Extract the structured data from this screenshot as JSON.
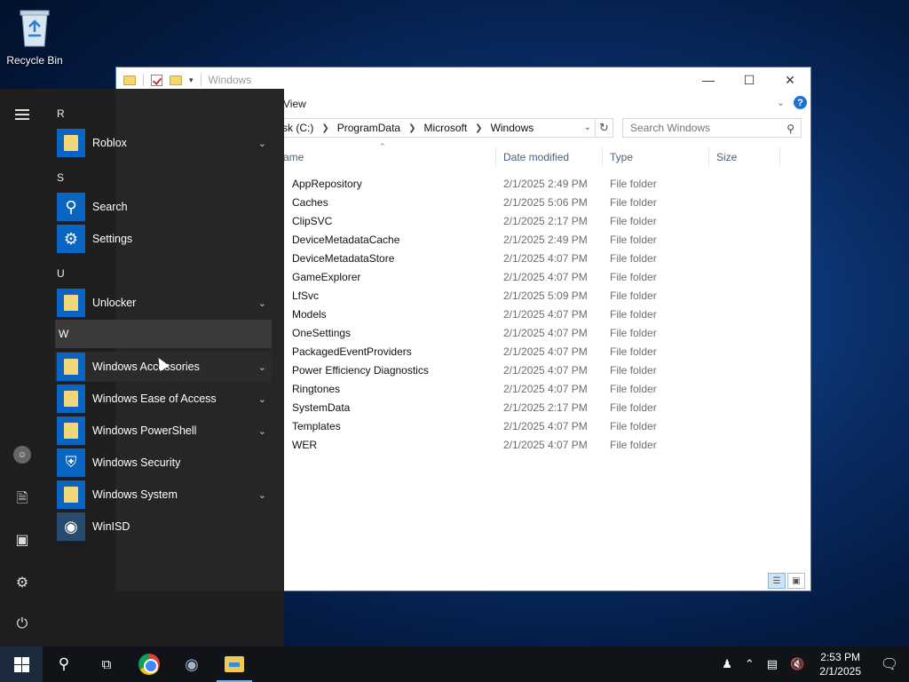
{
  "desktop": {
    "recycle_bin_label": "Recycle Bin"
  },
  "explorer": {
    "title": "Windows",
    "ribbon_view_tab": "View",
    "path": [
      "sk (C:)",
      "ProgramData",
      "Microsoft",
      "Windows"
    ],
    "search_placeholder": "Search Windows",
    "columns": {
      "name": "ame",
      "date": "Date modified",
      "type": "Type",
      "size": "Size"
    },
    "rows": [
      {
        "name": "AppRepository",
        "date": "2/1/2025 2:49 PM",
        "type": "File folder"
      },
      {
        "name": "Caches",
        "date": "2/1/2025 5:06 PM",
        "type": "File folder"
      },
      {
        "name": "ClipSVC",
        "date": "2/1/2025 2:17 PM",
        "type": "File folder"
      },
      {
        "name": "DeviceMetadataCache",
        "date": "2/1/2025 2:49 PM",
        "type": "File folder"
      },
      {
        "name": "DeviceMetadataStore",
        "date": "2/1/2025 4:07 PM",
        "type": "File folder"
      },
      {
        "name": "GameExplorer",
        "date": "2/1/2025 4:07 PM",
        "type": "File folder"
      },
      {
        "name": "LfSvc",
        "date": "2/1/2025 5:09 PM",
        "type": "File folder"
      },
      {
        "name": "Models",
        "date": "2/1/2025 4:07 PM",
        "type": "File folder"
      },
      {
        "name": "OneSettings",
        "date": "2/1/2025 4:07 PM",
        "type": "File folder"
      },
      {
        "name": "PackagedEventProviders",
        "date": "2/1/2025 4:07 PM",
        "type": "File folder"
      },
      {
        "name": "Power Efficiency Diagnostics",
        "date": "2/1/2025 4:07 PM",
        "type": "File folder"
      },
      {
        "name": "Ringtones",
        "date": "2/1/2025 4:07 PM",
        "type": "File folder"
      },
      {
        "name": "SystemData",
        "date": "2/1/2025 2:17 PM",
        "type": "File folder"
      },
      {
        "name": "Templates",
        "date": "2/1/2025 4:07 PM",
        "type": "File folder"
      },
      {
        "name": "WER",
        "date": "2/1/2025 4:07 PM",
        "type": "File folder"
      }
    ]
  },
  "start_menu": {
    "letters": {
      "r": "R",
      "s": "S",
      "u": "U",
      "w": "W"
    },
    "apps": {
      "roblox": "Roblox",
      "search": "Search",
      "settings": "Settings",
      "unlocker": "Unlocker",
      "win_accessories": "Windows Accessories",
      "win_ease": "Windows Ease of Access",
      "win_powershell": "Windows PowerShell",
      "win_security": "Windows Security",
      "win_system": "Windows System",
      "winisd": "WinISD"
    }
  },
  "taskbar": {
    "time": "2:53 PM",
    "date": "2/1/2025"
  }
}
